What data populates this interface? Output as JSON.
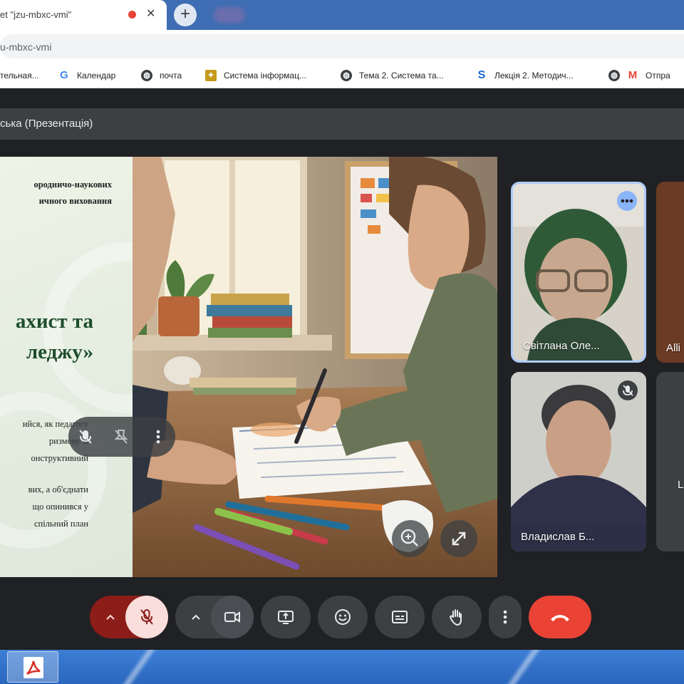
{
  "browser": {
    "tab_title": "et \"jzu-mbxc-vmi\"",
    "tab_close": "✕",
    "new_tab": "+",
    "url": "u-mbxc-vmi",
    "bookmarks": [
      {
        "label": "тельная...",
        "icon": "none"
      },
      {
        "label": "Календар",
        "icon": "google-icon"
      },
      {
        "label": "почта",
        "icon": "globe-icon"
      },
      {
        "label": "Система інформац...",
        "icon": "square-logo-icon"
      },
      {
        "label": "Тема 2. Система та...",
        "icon": "globe-icon"
      },
      {
        "label": "Лекція 2. Методич...",
        "icon": "s-logo-icon"
      },
      {
        "label": "Отпра",
        "icon": "gmail-icon"
      }
    ]
  },
  "meet": {
    "presenter_title": "ська (Презентація)",
    "slide": {
      "lines_small": [
        "ородничо-наукових",
        "ичного виховання"
      ],
      "headline": [
        "ахист та",
        "леджу»"
      ],
      "paragraph1": [
        "ийся, як педагогу",
        "ризмову зі",
        "онструктивний"
      ],
      "paragraph2": [
        "вих, а об'єднати",
        "що опинився у",
        "спільний план"
      ]
    },
    "participants": [
      {
        "name": "Світлана Оле...",
        "status": "more-options",
        "active_speaker": true
      },
      {
        "name": "Владислав Б...",
        "status": "muted"
      },
      {
        "name": "Alli",
        "status": ""
      },
      {
        "name": "L",
        "status": ""
      }
    ],
    "controls": [
      "mic-options",
      "mic-muted",
      "camera-options",
      "camera",
      "present",
      "emoji",
      "captions",
      "raise-hand",
      "more",
      "leave-call"
    ]
  },
  "colors": {
    "chrome_frame": "#3f6db3",
    "meet_bg": "#202124",
    "meet_button": "#3c4043",
    "mic_off": "#f9dedc",
    "mic_options": "#8c1d18",
    "end_call": "#ea4335",
    "speaker_border": "#aecbfa",
    "slide_green": "#1e4d2b"
  },
  "taskbar": {
    "apps": [
      "acrobat-pdf-icon"
    ]
  }
}
